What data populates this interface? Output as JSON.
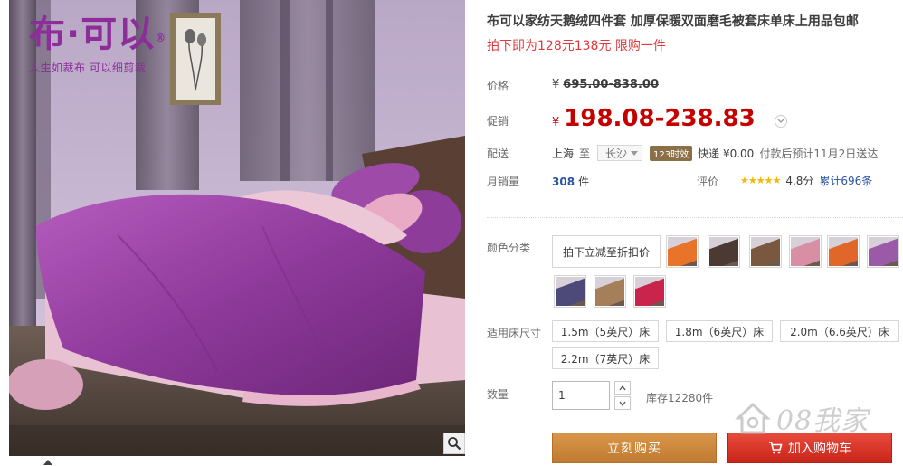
{
  "brand": {
    "logo_text": "布·可以",
    "slogan": "人生如裁布 可以细剪裁"
  },
  "product": {
    "title": "布可以家纺天鹅绒四件套 加厚保暖双面磨毛被套床单床上用品包邮",
    "promo_line": "拍下即为128元138元 限购一件"
  },
  "price": {
    "label": "价格",
    "currency": "¥",
    "original": "695.00-838.00",
    "promo_label": "促销",
    "promo": "198.08-238.83"
  },
  "shipping": {
    "label": "配送",
    "from": "上海",
    "to_word": "至",
    "city": "长沙",
    "eta_badge": "123时效",
    "fee": "快递 ¥0.00",
    "note": "付款后预计11月2日送达"
  },
  "sales": {
    "label": "月销量",
    "count": "308",
    "unit": "件"
  },
  "rating": {
    "label": "评价",
    "stars": "★★★★★",
    "score": "4.8分",
    "reviews": "累计696条"
  },
  "sku": {
    "color_label": "颜色分类",
    "color_text_option": "拍下立减至折扣价",
    "swatches": [
      {
        "name": "orange",
        "color": "#e8742a"
      },
      {
        "name": "dark-brown",
        "color": "#4a3a33"
      },
      {
        "name": "coffee",
        "color": "#7a5840"
      },
      {
        "name": "pink",
        "color": "#d98fa3"
      },
      {
        "name": "orange-grey",
        "color": "#e0662a"
      },
      {
        "name": "purple",
        "color": "#9a5aa8"
      },
      {
        "name": "navy-purple",
        "color": "#4d4a7a"
      },
      {
        "name": "camel",
        "color": "#a57e5a"
      },
      {
        "name": "rose-red",
        "color": "#c8244c"
      }
    ],
    "size_label": "适用床尺寸",
    "sizes": [
      "1.5m（5英尺）床",
      "1.8m（6英尺）床",
      "2.0m（6.6英尺）床",
      "2.2m（7英尺）床"
    ]
  },
  "quantity": {
    "label": "数量",
    "value": "1",
    "stock": "库存12280件"
  },
  "actions": {
    "buy_now": "立刻购买",
    "add_to_cart": "加入购物车"
  },
  "watermark": {
    "text": "08我家"
  },
  "colors": {
    "price_red": "#c40000",
    "promo_red": "#e4393c",
    "link_blue": "#2953a6",
    "buy_orange": "#c8863e",
    "cart_red": "#d9291c"
  }
}
